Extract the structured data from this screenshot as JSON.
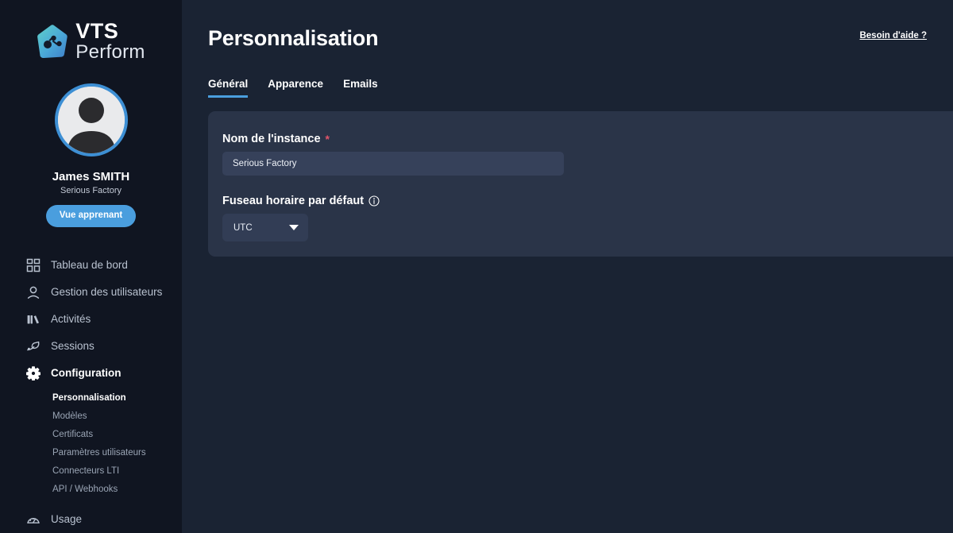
{
  "sidebar": {
    "logo": {
      "line1": "VTS",
      "line2": "Perform",
      "icon": "vts-network-hexagon-logo"
    },
    "profile": {
      "avatar_icon": "user-avatar-icon",
      "name": "James SMITH",
      "org": "Serious Factory",
      "learner_button": "Vue apprenant"
    },
    "nav": [
      {
        "label": "Tableau de bord",
        "icon": "dashboard-grid-icon",
        "active": false
      },
      {
        "label": "Gestion des utilisateurs",
        "icon": "user-management-icon",
        "active": false
      },
      {
        "label": "Activités",
        "icon": "activities-books-icon",
        "active": false
      },
      {
        "label": "Sessions",
        "icon": "sessions-sprout-icon",
        "active": false
      },
      {
        "label": "Configuration",
        "icon": "gear-icon",
        "active": true
      }
    ],
    "subnav": [
      {
        "label": "Personnalisation",
        "active": true
      },
      {
        "label": "Modèles",
        "active": false
      },
      {
        "label": "Certificats",
        "active": false
      },
      {
        "label": "Paramètres utilisateurs",
        "active": false
      },
      {
        "label": "Connecteurs LTI",
        "active": false
      },
      {
        "label": "API / Webhooks",
        "active": false
      }
    ],
    "usage": {
      "label": "Usage",
      "icon": "gauge-speedometer-icon"
    }
  },
  "header": {
    "title": "Personnalisation",
    "help_link": "Besoin d'aide ?"
  },
  "tabs": [
    {
      "label": "Général",
      "active": true
    },
    {
      "label": "Apparence",
      "active": false
    },
    {
      "label": "Emails",
      "active": false
    }
  ],
  "form": {
    "instance_name": {
      "label": "Nom de l'instance",
      "required_marker": "*",
      "value": "Serious Factory",
      "placeholder": "Nom de l'instance"
    },
    "timezone": {
      "label": "Fuseau horaire par défaut",
      "info_icon": "info-circle-icon",
      "value": "UTC",
      "options": [
        "UTC"
      ]
    }
  },
  "colors": {
    "sidebar_bg": "#101521",
    "main_bg": "#1a2333",
    "card_bg": "#2a3448",
    "input_bg": "#36415a",
    "accent_blue": "#4a9ede",
    "scrollbar_blue": "#5ba4e5",
    "required_red": "#e2556a"
  }
}
